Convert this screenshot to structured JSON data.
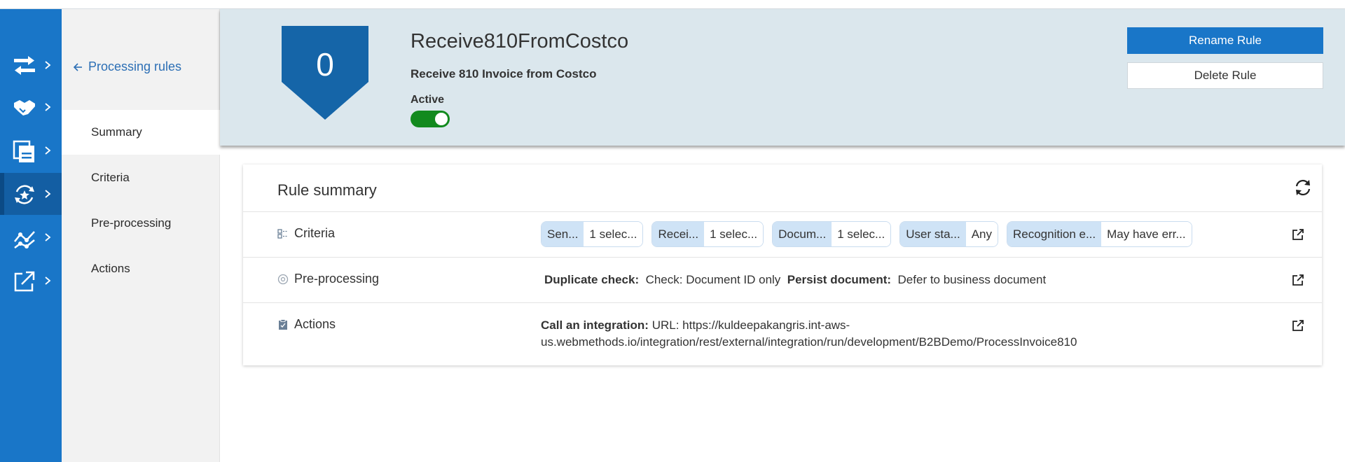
{
  "colors": {
    "rail": "#1976c8",
    "accent": "#1976c8",
    "header_bg": "#dbe7ed",
    "toggle_on": "#128a1e",
    "badge": "#1565a8"
  },
  "rail": {
    "items": [
      {
        "icon": "transfer-icon"
      },
      {
        "icon": "handshake-icon"
      },
      {
        "icon": "documents-icon"
      },
      {
        "icon": "processing-rules-icon",
        "active": true
      },
      {
        "icon": "analytics-icon"
      },
      {
        "icon": "export-icon"
      }
    ]
  },
  "subnav": {
    "back_label": "Processing rules",
    "items": [
      "Summary",
      "Criteria",
      "Pre-processing",
      "Actions"
    ],
    "selected": "Summary"
  },
  "header": {
    "badge_value": "0",
    "title": "Receive810FromCostco",
    "description": "Receive 810 Invoice from Costco",
    "status_label": "Active",
    "active": true,
    "rename_label": "Rename Rule",
    "delete_label": "Delete Rule"
  },
  "summary": {
    "title": "Rule summary",
    "criteria": {
      "label": "Criteria",
      "chips": [
        {
          "key": "Sen...",
          "value": "1 selec..."
        },
        {
          "key": "Recei...",
          "value": "1 selec..."
        },
        {
          "key": "Docum...",
          "value": "1 selec..."
        },
        {
          "key": "User sta...",
          "value": "Any"
        },
        {
          "key": "Recognition e...",
          "value": "May have err..."
        }
      ]
    },
    "preprocessing": {
      "label": "Pre-processing",
      "duplicate_label": "Duplicate check:",
      "duplicate_value": "Check:  Document ID only",
      "persist_label": "Persist document:",
      "persist_value": "Defer to business document"
    },
    "actions": {
      "label": "Actions",
      "action_label": "Call an integration:",
      "action_value_line1": "URL: https://kuldeepakangris.int-aws-",
      "action_value_line2": "us.webmethods.io/integration/rest/external/integration/run/development/B2BDemo/ProcessInvoice810"
    }
  }
}
